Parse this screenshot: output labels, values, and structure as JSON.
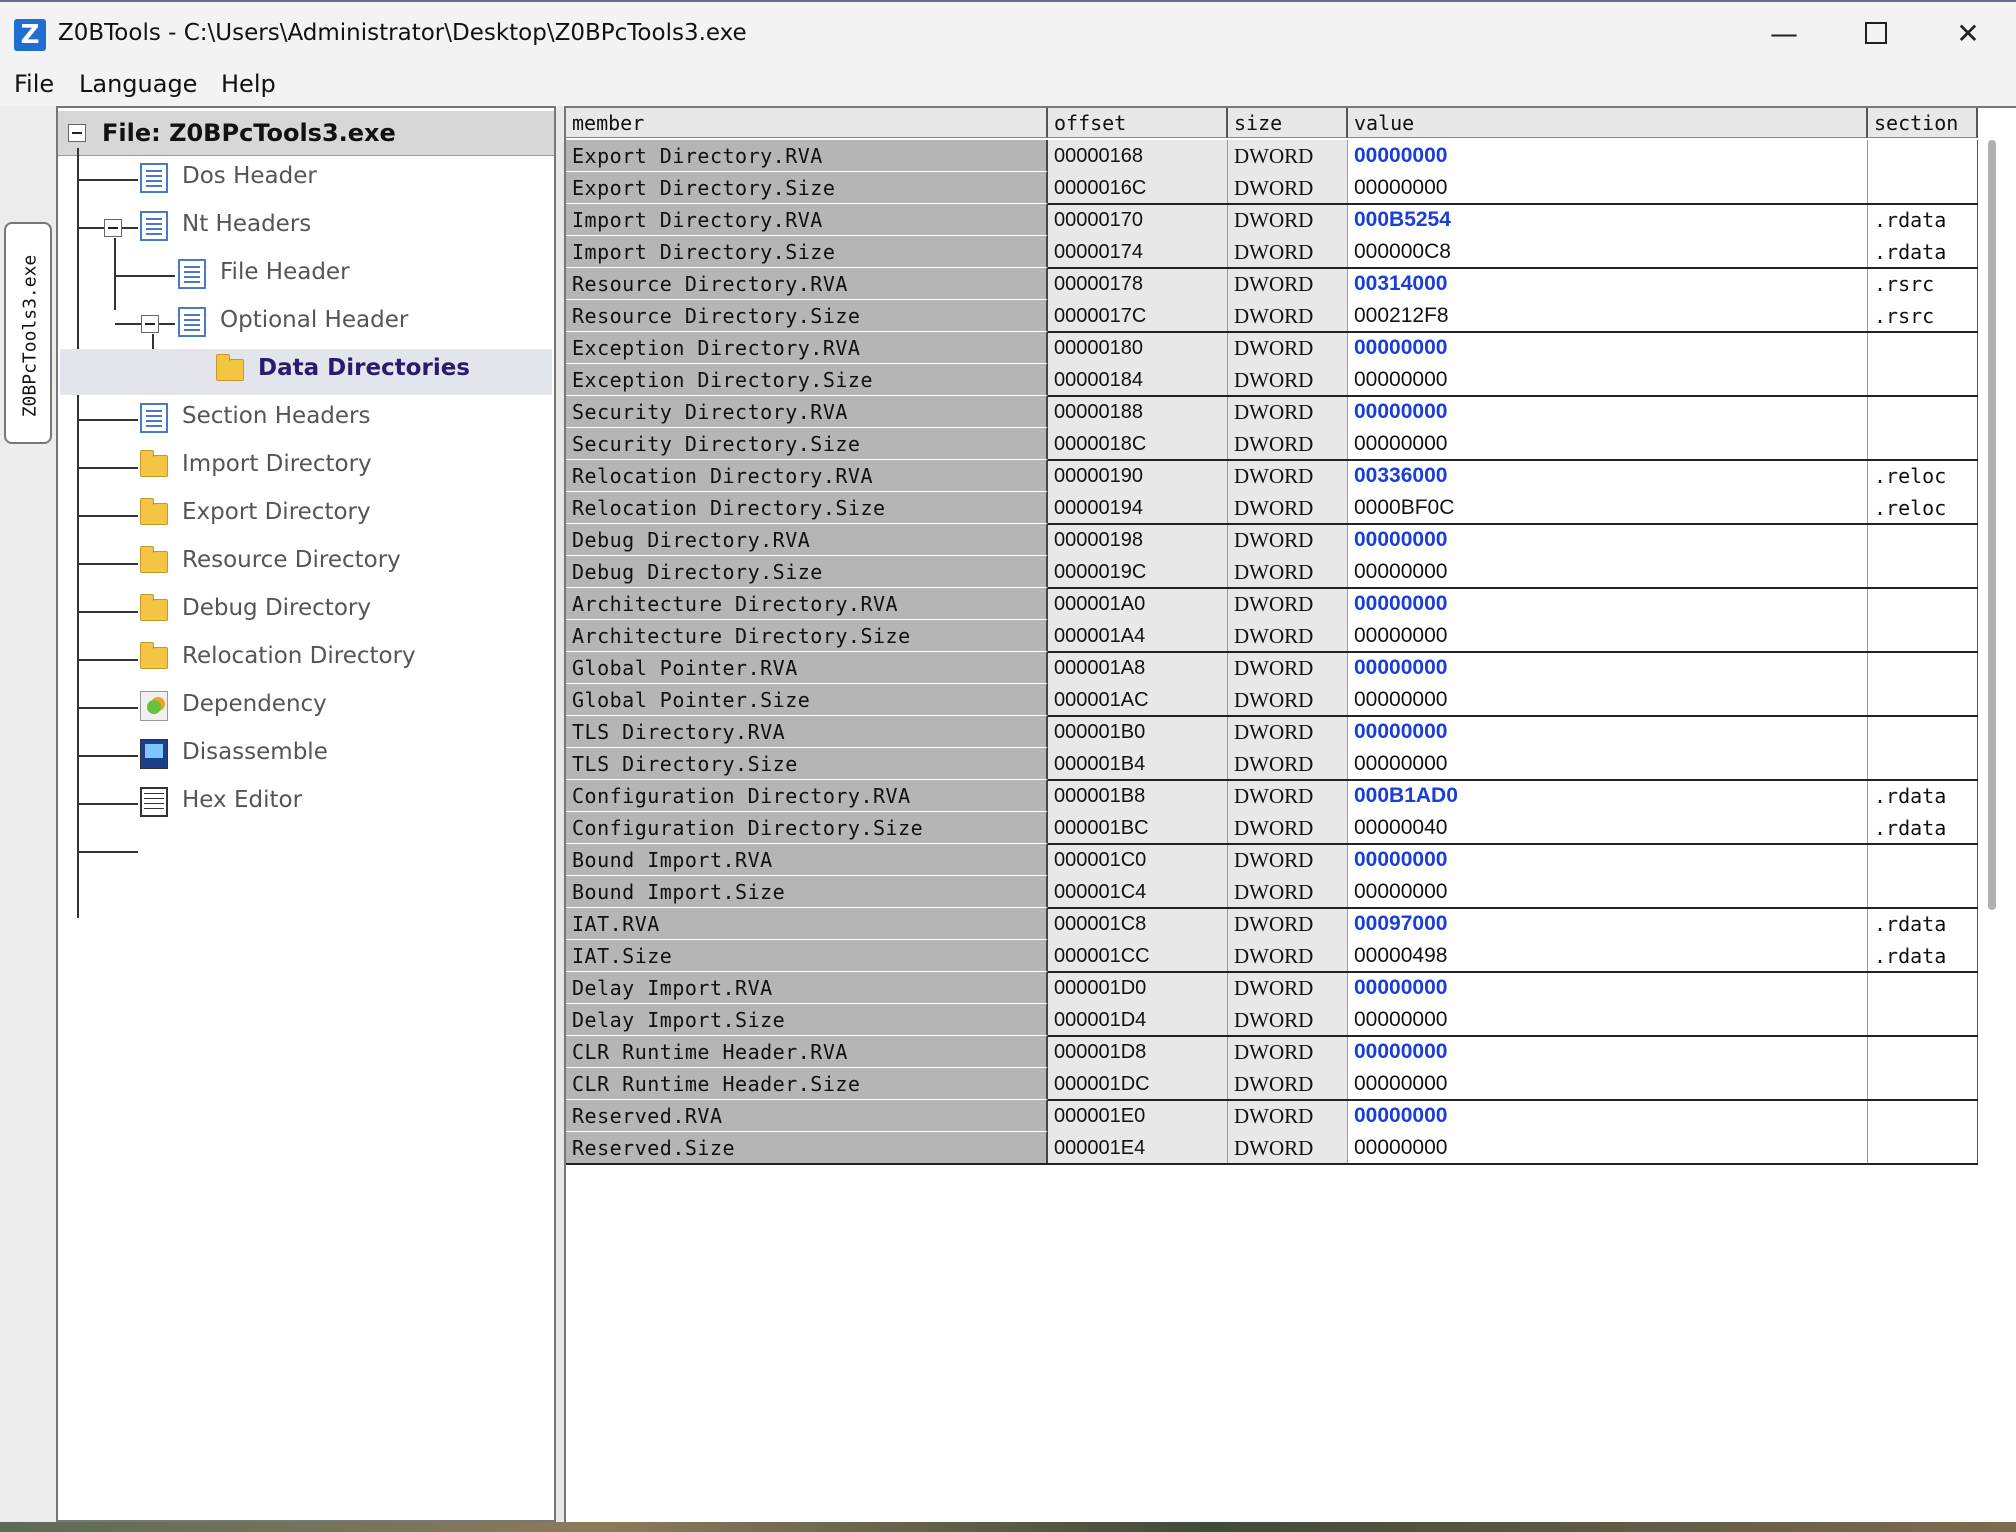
{
  "window": {
    "title": "Z0BTools - C:\\Users\\Administrator\\Desktop\\Z0BPcTools3.exe",
    "minimize_glyph": "—",
    "close_glyph": "✕"
  },
  "menu": {
    "file": "File",
    "language": "Language",
    "help": "Help"
  },
  "side_tab": {
    "label": "Z0BPcTools3.exe"
  },
  "tree": {
    "root_label": "File: Z0BPcTools3.exe",
    "items": {
      "dos_header": "Dos Header",
      "nt_headers": "Nt Headers",
      "file_header": "File Header",
      "optional_header": "Optional Header",
      "data_directories": "Data Directories",
      "section_headers": "Section Headers",
      "import_directory": "Import Directory",
      "export_directory": "Export Directory",
      "resource_directory": "Resource Directory",
      "debug_directory": "Debug Directory",
      "relocation_directory": "Relocation Directory",
      "dependency": "Dependency",
      "disassemble": "Disassemble",
      "hex_editor": "Hex Editor"
    },
    "selected": "data_directories"
  },
  "grid": {
    "headers": {
      "member": "member",
      "offset": "offset",
      "size": "size",
      "value": "value",
      "section": "section"
    },
    "rows": [
      {
        "member": "Export Directory.RVA",
        "offset": "00000168",
        "size": "DWORD",
        "value": "00000000",
        "section": ""
      },
      {
        "member": "Export Directory.Size",
        "offset": "0000016C",
        "size": "DWORD",
        "value": "00000000",
        "section": ""
      },
      {
        "member": "Import Directory.RVA",
        "offset": "00000170",
        "size": "DWORD",
        "value": "000B5254",
        "section": ".rdata"
      },
      {
        "member": "Import Directory.Size",
        "offset": "00000174",
        "size": "DWORD",
        "value": "000000C8",
        "section": ".rdata"
      },
      {
        "member": "Resource Directory.RVA",
        "offset": "00000178",
        "size": "DWORD",
        "value": "00314000",
        "section": ".rsrc"
      },
      {
        "member": "Resource Directory.Size",
        "offset": "0000017C",
        "size": "DWORD",
        "value": "000212F8",
        "section": ".rsrc"
      },
      {
        "member": "Exception Directory.RVA",
        "offset": "00000180",
        "size": "DWORD",
        "value": "00000000",
        "section": ""
      },
      {
        "member": "Exception Directory.Size",
        "offset": "00000184",
        "size": "DWORD",
        "value": "00000000",
        "section": ""
      },
      {
        "member": "Security Directory.RVA",
        "offset": "00000188",
        "size": "DWORD",
        "value": "00000000",
        "section": ""
      },
      {
        "member": "Security Directory.Size",
        "offset": "0000018C",
        "size": "DWORD",
        "value": "00000000",
        "section": ""
      },
      {
        "member": "Relocation Directory.RVA",
        "offset": "00000190",
        "size": "DWORD",
        "value": "00336000",
        "section": ".reloc"
      },
      {
        "member": "Relocation Directory.Size",
        "offset": "00000194",
        "size": "DWORD",
        "value": "0000BF0C",
        "section": ".reloc"
      },
      {
        "member": "Debug Directory.RVA",
        "offset": "00000198",
        "size": "DWORD",
        "value": "00000000",
        "section": ""
      },
      {
        "member": "Debug Directory.Size",
        "offset": "0000019C",
        "size": "DWORD",
        "value": "00000000",
        "section": ""
      },
      {
        "member": "Architecture Directory.RVA",
        "offset": "000001A0",
        "size": "DWORD",
        "value": "00000000",
        "section": ""
      },
      {
        "member": "Architecture Directory.Size",
        "offset": "000001A4",
        "size": "DWORD",
        "value": "00000000",
        "section": ""
      },
      {
        "member": "Global Pointer.RVA",
        "offset": "000001A8",
        "size": "DWORD",
        "value": "00000000",
        "section": ""
      },
      {
        "member": "Global Pointer.Size",
        "offset": "000001AC",
        "size": "DWORD",
        "value": "00000000",
        "section": ""
      },
      {
        "member": "TLS Directory.RVA",
        "offset": "000001B0",
        "size": "DWORD",
        "value": "00000000",
        "section": ""
      },
      {
        "member": "TLS Directory.Size",
        "offset": "000001B4",
        "size": "DWORD",
        "value": "00000000",
        "section": ""
      },
      {
        "member": "Configuration Directory.RVA",
        "offset": "000001B8",
        "size": "DWORD",
        "value": "000B1AD0",
        "section": ".rdata"
      },
      {
        "member": "Configuration Directory.Size",
        "offset": "000001BC",
        "size": "DWORD",
        "value": "00000040",
        "section": ".rdata"
      },
      {
        "member": "Bound Import.RVA",
        "offset": "000001C0",
        "size": "DWORD",
        "value": "00000000",
        "section": ""
      },
      {
        "member": "Bound Import.Size",
        "offset": "000001C4",
        "size": "DWORD",
        "value": "00000000",
        "section": ""
      },
      {
        "member": "IAT.RVA",
        "offset": "000001C8",
        "size": "DWORD",
        "value": "00097000",
        "section": ".rdata"
      },
      {
        "member": "IAT.Size",
        "offset": "000001CC",
        "size": "DWORD",
        "value": "00000498",
        "section": ".rdata"
      },
      {
        "member": "Delay Import.RVA",
        "offset": "000001D0",
        "size": "DWORD",
        "value": "00000000",
        "section": ""
      },
      {
        "member": "Delay Import.Size",
        "offset": "000001D4",
        "size": "DWORD",
        "value": "00000000",
        "section": ""
      },
      {
        "member": "CLR Runtime Header.RVA",
        "offset": "000001D8",
        "size": "DWORD",
        "value": "00000000",
        "section": ""
      },
      {
        "member": "CLR Runtime Header.Size",
        "offset": "000001DC",
        "size": "DWORD",
        "value": "00000000",
        "section": ""
      },
      {
        "member": "Reserved.RVA",
        "offset": "000001E0",
        "size": "DWORD",
        "value": "00000000",
        "section": ""
      },
      {
        "member": "Reserved.Size",
        "offset": "000001E4",
        "size": "DWORD",
        "value": "00000000",
        "section": ""
      }
    ]
  },
  "colors": {
    "rva_value": "#1a3fd6",
    "selected_tree_text": "#2b1a6e"
  }
}
